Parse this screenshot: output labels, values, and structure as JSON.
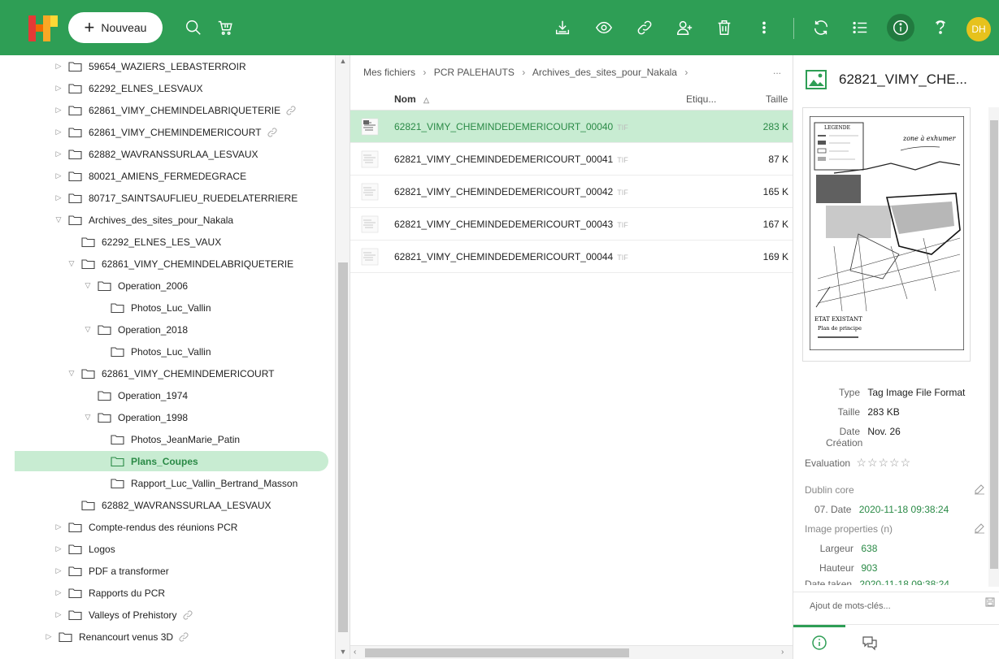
{
  "topbar": {
    "new_label": "Nouveau",
    "user_initials": "DH",
    "brand_color": "#2e9e55",
    "avatar_color": "#e6c21d",
    "icons_left": [
      "search-icon",
      "cart-icon"
    ],
    "icons_right": [
      "download-icon",
      "eye-icon",
      "link-icon",
      "add-user-icon",
      "trash-icon",
      "more-icon",
      "refresh-icon",
      "list-view-icon",
      "info-icon",
      "help-icon"
    ]
  },
  "tree": {
    "items": [
      {
        "label": "59654_WAZIERS_LEBASTERROIR",
        "depth": 1,
        "caret": "closed",
        "link": false
      },
      {
        "label": "62292_ELNES_LESVAUX",
        "depth": 1,
        "caret": "closed",
        "link": false
      },
      {
        "label": "62861_VIMY_CHEMINDELABRIQUETERIE",
        "depth": 1,
        "caret": "closed",
        "link": true
      },
      {
        "label": "62861_VIMY_CHEMINDEMERICOURT",
        "depth": 1,
        "caret": "closed",
        "link": true
      },
      {
        "label": "62882_WAVRANSSURLAA_LESVAUX",
        "depth": 1,
        "caret": "closed",
        "link": false
      },
      {
        "label": "80021_AMIENS_FERMEDEGRACE",
        "depth": 1,
        "caret": "closed",
        "link": false
      },
      {
        "label": "80717_SAINTSAUFLIEU_RUEDELATERRIERE",
        "depth": 1,
        "caret": "closed",
        "link": false
      },
      {
        "label": "Archives_des_sites_pour_Nakala",
        "depth": 1,
        "caret": "open",
        "link": false
      },
      {
        "label": "62292_ELNES_LES_VAUX",
        "depth": 2,
        "caret": "none",
        "link": false
      },
      {
        "label": "62861_VIMY_CHEMINDELABRIQUETERIE",
        "depth": 2,
        "caret": "open",
        "link": false
      },
      {
        "label": "Operation_2006",
        "depth": 3,
        "caret": "open",
        "link": false
      },
      {
        "label": "Photos_Luc_Vallin",
        "depth": 4,
        "caret": "none",
        "link": false
      },
      {
        "label": "Operation_2018",
        "depth": 3,
        "caret": "open",
        "link": false
      },
      {
        "label": "Photos_Luc_Vallin",
        "depth": 4,
        "caret": "none",
        "link": false
      },
      {
        "label": "62861_VIMY_CHEMINDEMERICOURT",
        "depth": 2,
        "caret": "open",
        "link": false
      },
      {
        "label": "Operation_1974",
        "depth": 3,
        "caret": "none",
        "link": false
      },
      {
        "label": "Operation_1998",
        "depth": 3,
        "caret": "open",
        "link": false
      },
      {
        "label": "Photos_JeanMarie_Patin",
        "depth": 4,
        "caret": "none",
        "link": false
      },
      {
        "label": "Plans_Coupes",
        "depth": 4,
        "caret": "none",
        "link": false,
        "selected": true
      },
      {
        "label": "Rapport_Luc_Vallin_Bertrand_Masson",
        "depth": 4,
        "caret": "none",
        "link": false
      },
      {
        "label": "62882_WAVRANSSURLAA_LESVAUX",
        "depth": 2,
        "caret": "none",
        "link": false
      },
      {
        "label": "Compte-rendus des réunions PCR",
        "depth": 1,
        "caret": "closed",
        "link": false
      },
      {
        "label": "Logos",
        "depth": 1,
        "caret": "closed",
        "link": false
      },
      {
        "label": "PDF a transformer",
        "depth": 1,
        "caret": "closed",
        "link": false
      },
      {
        "label": "Rapports du PCR",
        "depth": 1,
        "caret": "closed",
        "link": false
      },
      {
        "label": "Valleys of Prehistory",
        "depth": 1,
        "caret": "closed",
        "link": true
      },
      {
        "label": "Renancourt venus 3D",
        "depth": 0,
        "caret": "closed",
        "link": true
      }
    ]
  },
  "breadcrumb": {
    "parts": [
      "Mes fichiers",
      "PCR PALEHAUTS",
      "Archives_des_sites_pour_Nakala"
    ],
    "separator": "›",
    "more": "..."
  },
  "list": {
    "columns": {
      "name": "Nom",
      "tags": "Etiqu...",
      "size": "Taille"
    },
    "files": [
      {
        "name": "62821_VIMY_CHEMINDEDEMERICOURT_00040",
        "ext": "TIF",
        "size": "283 K",
        "selected": true
      },
      {
        "name": "62821_VIMY_CHEMINDEDEMERICOURT_00041",
        "ext": "TIF",
        "size": "87 K",
        "selected": false
      },
      {
        "name": "62821_VIMY_CHEMINDEDEMERICOURT_00042",
        "ext": "TIF",
        "size": "165 K",
        "selected": false
      },
      {
        "name": "62821_VIMY_CHEMINDEDEMERICOURT_00043",
        "ext": "TIF",
        "size": "167 K",
        "selected": false
      },
      {
        "name": "62821_VIMY_CHEMINDEDEMERICOURT_00044",
        "ext": "TIF",
        "size": "169 K",
        "selected": false
      }
    ]
  },
  "details": {
    "title": "62821_VIMY_CHE...",
    "preview": {
      "legend_title": "LEGENDE",
      "note1": "zone à exhumer",
      "note2": "ETAT EXISTANT",
      "note3": "Plan de principe"
    },
    "type_label": "Type",
    "type_value": "Tag Image File Format",
    "size_label": "Taille",
    "size_value": "283 KB",
    "date_label_1": "Date",
    "date_label_2": "Création",
    "date_value": "Nov. 26",
    "rating_label": "Evaluation",
    "rating_stars": "☆☆☆☆☆",
    "dublin_core_label": "Dublin core",
    "dc_date_label": "07. Date",
    "dc_date_value": "2020-11-18 09:38:24",
    "image_props_label": "Image properties (n)",
    "width_label": "Largeur",
    "width_value": "638",
    "height_label": "Hauteur",
    "height_value": "903",
    "date_taken_label": "Date taken",
    "date_taken_value": "2020-11-18 09:38:24",
    "keywords_placeholder": "Ajout de mots-clés..."
  }
}
